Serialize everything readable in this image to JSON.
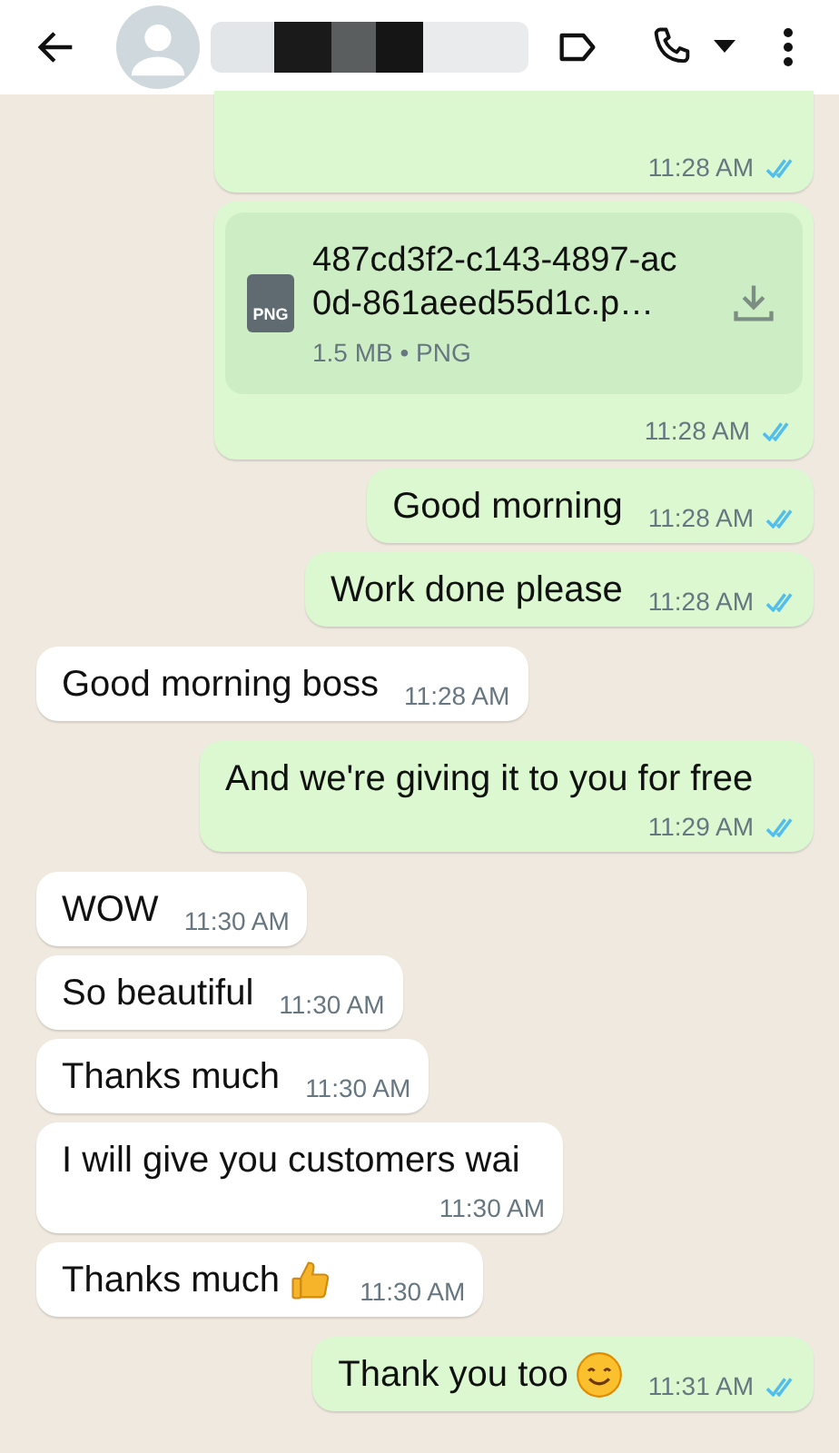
{
  "header": {
    "redacted_name": true
  },
  "messages": [
    {
      "kind": "cut",
      "outgoing": true,
      "time": "11:28 AM",
      "read": true
    },
    {
      "kind": "document",
      "outgoing": true,
      "file_badge": "PNG",
      "file_name": "487cd3f2-c143-4897-ac0d-861aeed55d1c.p…",
      "file_info": "1.5 MB • PNG",
      "time": "11:28 AM",
      "read": true
    },
    {
      "kind": "text",
      "outgoing": true,
      "text": "Good morning",
      "time": "11:28 AM",
      "read": true
    },
    {
      "kind": "text",
      "outgoing": true,
      "text": "Work done please",
      "time": "11:28 AM",
      "read": true
    },
    {
      "kind": "text",
      "outgoing": false,
      "text": "Good morning boss",
      "time": "11:28 AM"
    },
    {
      "kind": "text",
      "outgoing": true,
      "text": "And we're giving it to you for free",
      "time": "11:29 AM",
      "read": true
    },
    {
      "kind": "text",
      "outgoing": false,
      "text": "WOW",
      "time": "11:30 AM"
    },
    {
      "kind": "text",
      "outgoing": false,
      "text": "So beautiful",
      "time": "11:30 AM"
    },
    {
      "kind": "text",
      "outgoing": false,
      "text": "Thanks much",
      "time": "11:30 AM"
    },
    {
      "kind": "text",
      "outgoing": false,
      "text": "I will give you customers wai",
      "time": "11:30 AM"
    },
    {
      "kind": "text",
      "outgoing": false,
      "text": "Thanks much",
      "thumbs_up": true,
      "time": "11:30 AM"
    },
    {
      "kind": "text",
      "outgoing": true,
      "text": "Thank you too",
      "smiley": true,
      "time": "11:31 AM",
      "read": true
    }
  ]
}
